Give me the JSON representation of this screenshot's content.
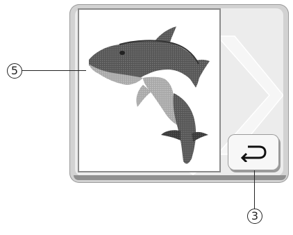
{
  "callouts": {
    "image_area": "5",
    "return_key": "3"
  },
  "icons": {
    "return": "return-arrow-icon",
    "preview": "dolphin-embroidery-image"
  },
  "colors": {
    "panel": "#d2d2d2",
    "panel_inner": "#ececec",
    "frame_border": "#8a8a8a",
    "button_face": "#f7f7f7"
  }
}
